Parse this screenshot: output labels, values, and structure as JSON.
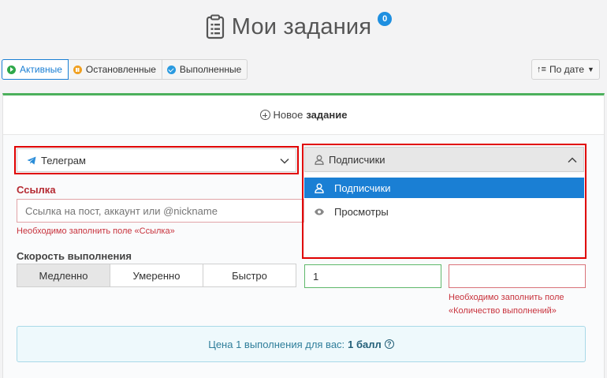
{
  "header": {
    "title": "Мои задания",
    "badge_count": "0"
  },
  "filters": [
    {
      "label": "Активные",
      "icon": "play-circle-icon",
      "active": true
    },
    {
      "label": "Остановленные",
      "icon": "pause-circle-icon",
      "active": false
    },
    {
      "label": "Выполненные",
      "icon": "check-circle-icon",
      "active": false
    }
  ],
  "sort": {
    "label": "По дате"
  },
  "new_task": {
    "prefix": "Новое",
    "bold": "задание"
  },
  "network_select": {
    "value": "Телеграм",
    "icon": "telegram-icon"
  },
  "type_select": {
    "value": "Подписчики",
    "icon": "user-icon",
    "expanded": true
  },
  "type_options": [
    {
      "label": "Подписчики",
      "icon": "user-icon",
      "selected": true
    },
    {
      "label": "Просмотры",
      "icon": "eye-icon",
      "selected": false
    }
  ],
  "link": {
    "label": "Ссылка",
    "placeholder": "Ссылка на пост, аккаунт или @nickname",
    "error": "Необходимо заполнить поле «Ссылка»"
  },
  "speed": {
    "label": "Скорость выполнения",
    "options": [
      "Медленно",
      "Умеренно",
      "Быстро"
    ],
    "selected": "Медленно"
  },
  "field_a": {
    "value": "1"
  },
  "quantity": {
    "value": "",
    "error_line1": "Необходимо заполнить поле",
    "error_line2": "«Количество выполнений»"
  },
  "price": {
    "prefix": "Цена 1 выполнения для вас:",
    "value": "1 балл"
  },
  "colors": {
    "accent": "#1a7fd4",
    "success": "#4cb05c",
    "error": "#e00000",
    "error_text": "#c8323c",
    "info_bg": "#eef9fc"
  }
}
